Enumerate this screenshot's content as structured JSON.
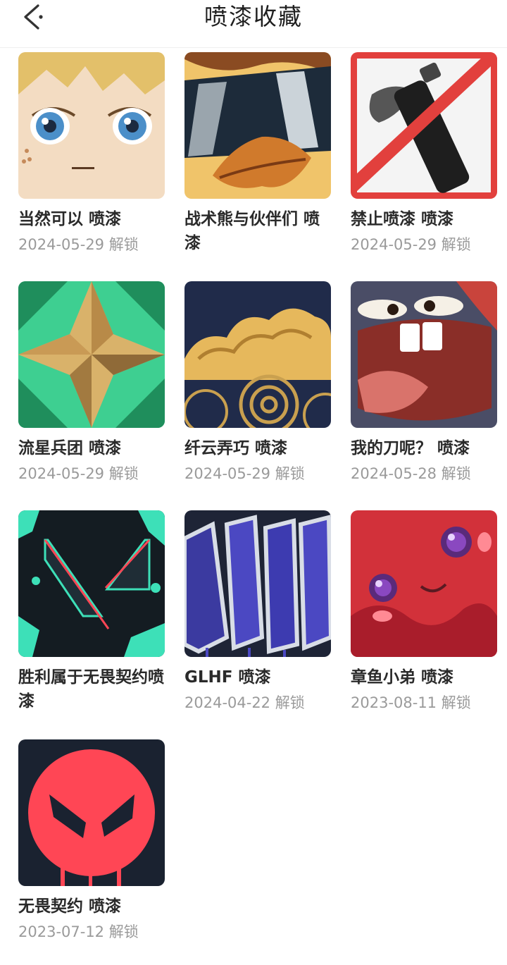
{
  "header": {
    "title": "喷漆收藏",
    "back_icon": "chevron-left-icon"
  },
  "sprays": [
    {
      "name": "当然可以 喷漆",
      "date": "2024-05-29 解锁"
    },
    {
      "name": "战术熊与伙伴们 喷漆",
      "date": ""
    },
    {
      "name": "禁止喷漆 喷漆",
      "date": "2024-05-29 解锁"
    },
    {
      "name": "流星兵团 喷漆",
      "date": "2024-05-29 解锁"
    },
    {
      "name": "纤云弄巧 喷漆",
      "date": "2024-05-29 解锁"
    },
    {
      "name": "我的刀呢？ 喷漆",
      "date": "2024-05-28 解锁"
    },
    {
      "name": "胜利属于无畏契约喷漆",
      "date": ""
    },
    {
      "name": "GLHF 喷漆",
      "date": "2024-04-22 解锁"
    },
    {
      "name": "章鱼小弟 喷漆",
      "date": "2023-08-11 解锁"
    },
    {
      "name": "无畏契约 喷漆",
      "date": "2023-07-12 解锁"
    }
  ]
}
